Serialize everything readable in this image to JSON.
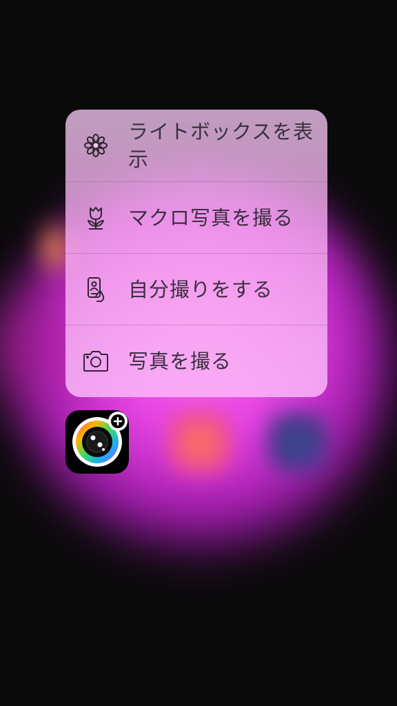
{
  "quick_actions": [
    {
      "label": "ライトボックスを表示",
      "icon": "flower-icon"
    },
    {
      "label": "マクロ写真を撮る",
      "icon": "tulip-icon"
    },
    {
      "label": "自分撮りをする",
      "icon": "selfie-phone-icon"
    },
    {
      "label": "写真を撮る",
      "icon": "camera-icon"
    }
  ],
  "app": {
    "icon": "camera-lens-icon",
    "badge_icon": "plus-icon"
  },
  "colors": {
    "menu_text": "#3a3040",
    "glow": "#e23fe0"
  }
}
